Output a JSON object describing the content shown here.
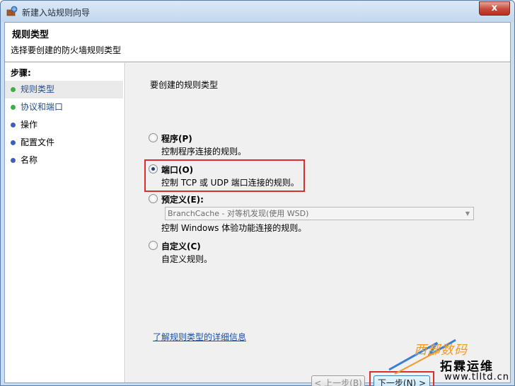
{
  "window": {
    "title": "新建入站规则向导",
    "close_label": "x"
  },
  "header": {
    "title": "规则类型",
    "subtitle": "选择要创建的防火墙规则类型"
  },
  "steps": {
    "heading": "步骤:",
    "items": [
      {
        "label": "规则类型",
        "dot_color": "#3fae49"
      },
      {
        "label": "协议和端口",
        "dot_color": "#3fae49"
      },
      {
        "label": "操作",
        "dot_color": "#3e5fc0"
      },
      {
        "label": "配置文件",
        "dot_color": "#3e5fc0"
      },
      {
        "label": "名称",
        "dot_color": "#3e5fc0"
      }
    ]
  },
  "content": {
    "question": "要创建的规则类型",
    "options": [
      {
        "title": "程序(P)",
        "desc": "控制程序连接的规则。",
        "checked": false
      },
      {
        "title": "端口(O)",
        "desc": "控制 TCP 或 UDP 端口连接的规则。",
        "checked": true
      },
      {
        "title": "预定义(E):",
        "desc": "控制 Windows 体验功能连接的规则。",
        "checked": false
      },
      {
        "title": "自定义(C)",
        "desc": "自定义规则。",
        "checked": false
      }
    ],
    "predefined_select": {
      "value": "BranchCache - 对等机发现(使用 WSD)",
      "enabled": false
    },
    "help_link": "了解规则类型的详细信息"
  },
  "buttons": {
    "back": "< 上一步(B)",
    "next": "下一步(N) >"
  },
  "watermark": {
    "line1": "西部数码",
    "line2": "拓霖运维",
    "url": "www.tlltd.cn"
  },
  "colors": {
    "highlight": "#d92f2f",
    "link": "#1a4fa0"
  }
}
